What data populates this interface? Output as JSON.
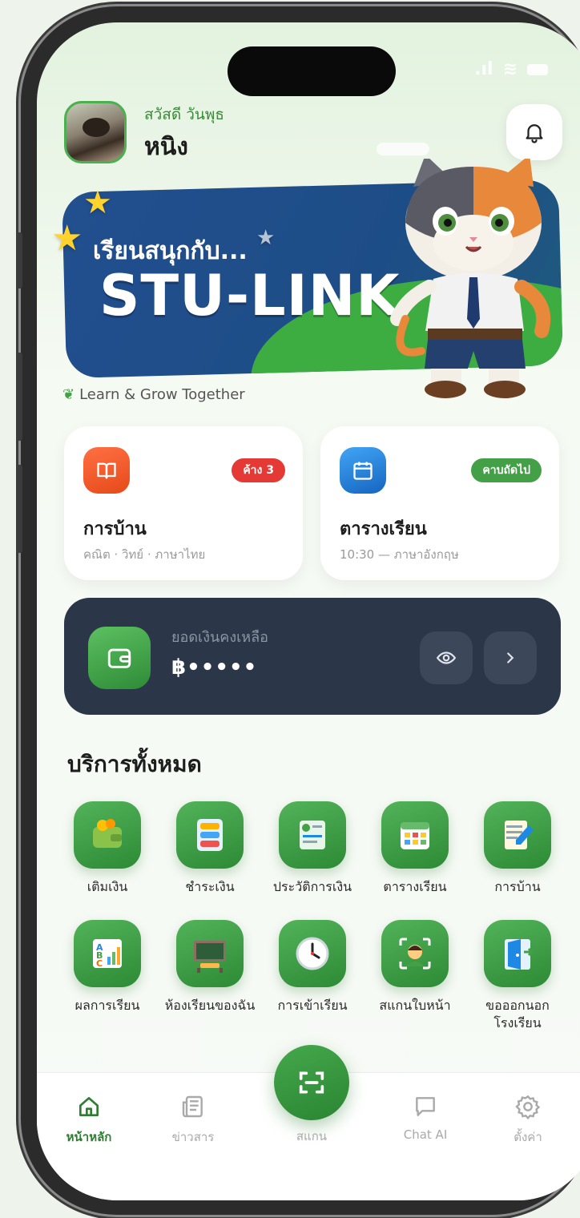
{
  "header": {
    "greeting": "สวัสดี วันพุธ",
    "name": "หนิง"
  },
  "banner": {
    "subtitle": "เรียนสนุกกับ...",
    "title": "STU-LINK",
    "tagline": "Learn & Grow Together"
  },
  "cards": {
    "homework": {
      "title": "การบ้าน",
      "subtitle": "คณิต · วิทย์ · ภาษาไทย",
      "badge": "ค้าง 3",
      "badge_color": "#e53935",
      "icon_color": "#f4511e"
    },
    "schedule": {
      "title": "ตารางเรียน",
      "subtitle": "10:30 — ภาษาอังกฤษ",
      "badge": "คาบถัดไป",
      "badge_color": "#43a047",
      "icon_color": "#1e88e5"
    }
  },
  "balance": {
    "label": "ยอดเงินคงเหลือ",
    "amount": "฿•••••"
  },
  "services": {
    "title": "บริการทั้งหมด",
    "items": [
      {
        "label": "เติมเงิน",
        "icon": "wallet-coins-icon"
      },
      {
        "label": "ชำระเงิน",
        "icon": "bill-list-icon"
      },
      {
        "label": "ประวัติการเงิน",
        "icon": "receipt-history-icon"
      },
      {
        "label": "ตารางเรียน",
        "icon": "calendar-grid-icon"
      },
      {
        "label": "การบ้าน",
        "icon": "notebook-pen-icon"
      },
      {
        "label": "ผลการเรียน",
        "icon": "grade-chart-icon"
      },
      {
        "label": "ห้องเรียนของฉัน",
        "icon": "chalkboard-icon"
      },
      {
        "label": "การเข้าเรียน",
        "icon": "clock-icon"
      },
      {
        "label": "สแกนใบหน้า",
        "icon": "face-scan-icon"
      },
      {
        "label": "ขอออกนอกโรงเรียน",
        "icon": "exit-door-icon"
      }
    ]
  },
  "nav": {
    "home": "หน้าหลัก",
    "news": "ข่าวสาร",
    "scan": "สแกน",
    "chat": "Chat AI",
    "settings": "ตั้งค่า"
  },
  "colors": {
    "accent": "#2e7d32",
    "balance_bg": "#2b3748"
  }
}
